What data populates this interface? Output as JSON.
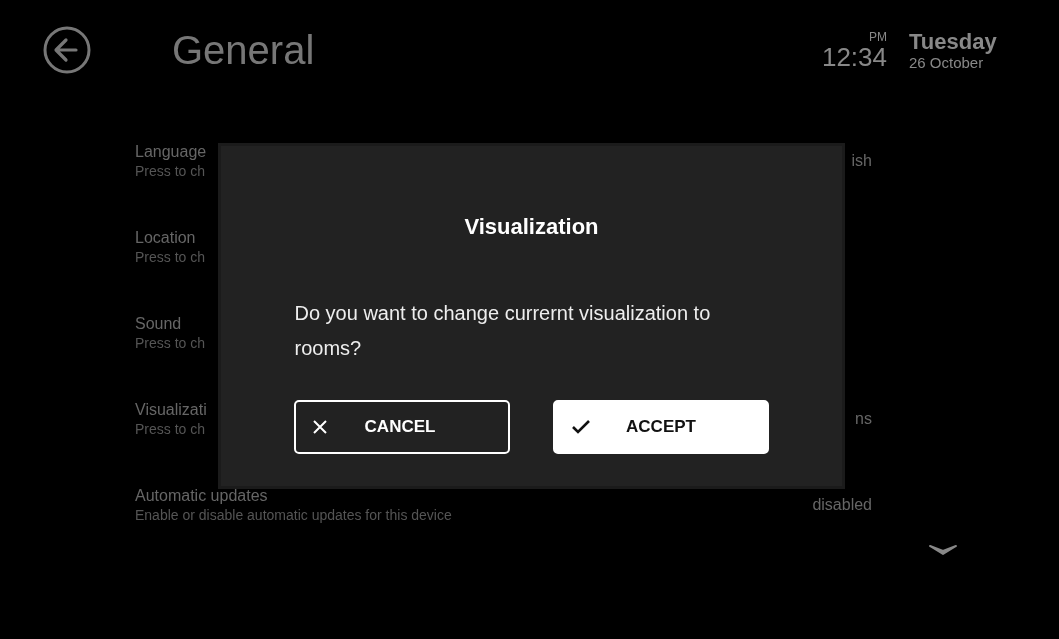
{
  "header": {
    "title": "General",
    "period": "PM",
    "time": "12:34",
    "weekday": "Tuesday",
    "date": "26 October"
  },
  "settings": [
    {
      "title": "Language",
      "subtitle": "Press to ch",
      "value": "ish"
    },
    {
      "title": "Location",
      "subtitle": "Press to ch"
    },
    {
      "title": "Sound",
      "subtitle": "Press to ch"
    },
    {
      "title": "Visualizati",
      "subtitle": "Press to ch",
      "value": "ns"
    },
    {
      "title": "Automatic updates",
      "subtitle": "Enable or disable automatic updates for this device",
      "value": "disabled"
    }
  ],
  "dialog": {
    "title": "Visualization",
    "message": "Do you want to change currernt visualization to rooms?",
    "buttons": [
      {
        "kind": "cancel",
        "label": "CANCEL"
      },
      {
        "kind": "accept",
        "label": "ACCEPT"
      }
    ]
  }
}
